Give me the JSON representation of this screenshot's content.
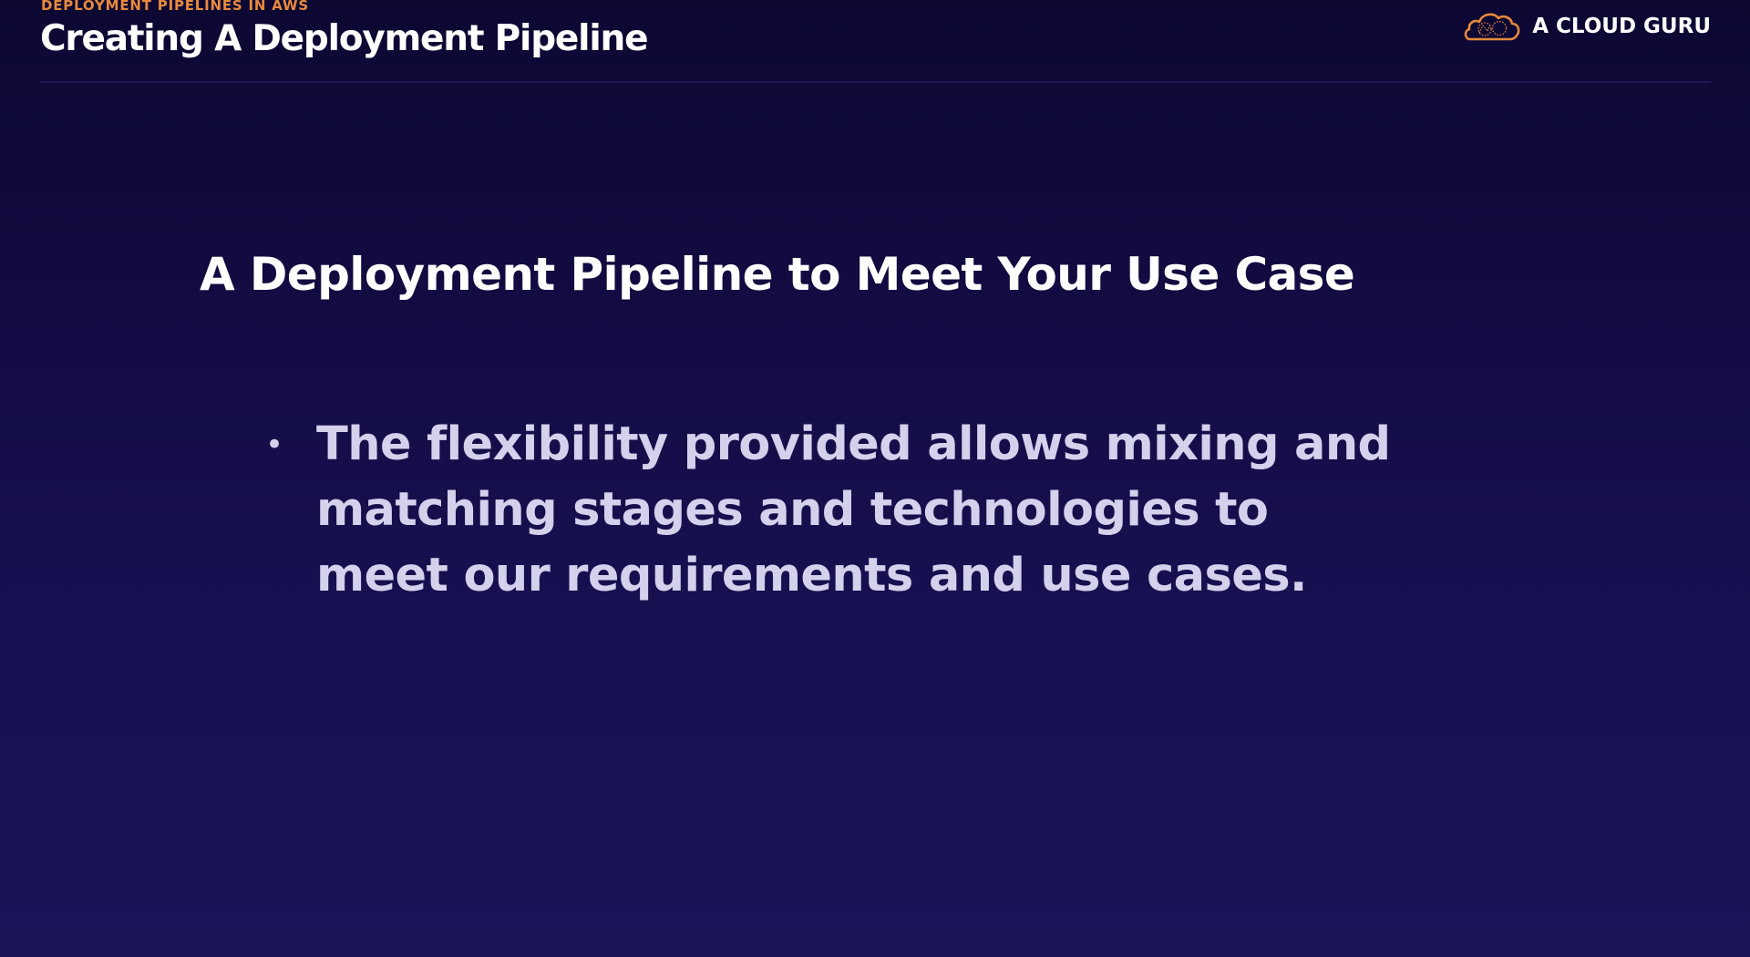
{
  "header": {
    "eyebrow": "DEPLOYMENT PIPELINES IN AWS",
    "title": "Creating A Deployment Pipeline"
  },
  "brand": {
    "name": "A CLOUD GURU",
    "logo_icon": "cloud-logo-icon",
    "logo_color": "#e8893c"
  },
  "slide": {
    "heading": "A Deployment Pipeline to Meet Your Use Case",
    "bullets": [
      {
        "marker": "•",
        "text": "The flexibility provided allows mixing and matching stages and technologies to meet our requirements and use cases."
      }
    ]
  },
  "colors": {
    "accent": "#e8893c",
    "title": "#ffffff",
    "body_text": "#d3d1ec",
    "background_top": "#0c0832",
    "background_bottom": "#1b1558"
  }
}
